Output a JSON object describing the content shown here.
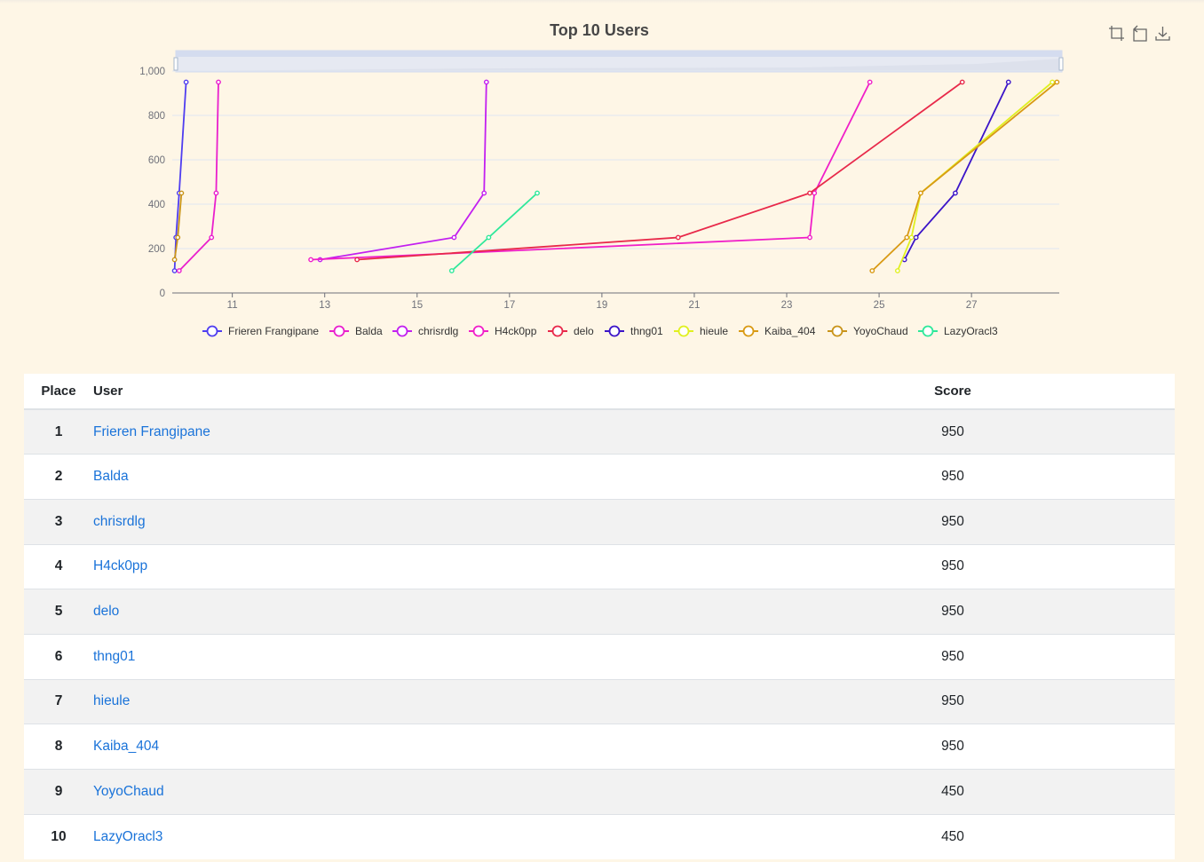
{
  "chart_data": {
    "type": "line",
    "title": "Top 10 Users",
    "xlabel": "",
    "ylabel": "",
    "xlim": [
      9.7,
      28.9
    ],
    "ylim": [
      0,
      1000
    ],
    "x_ticks": [
      "11",
      "13",
      "15",
      "17",
      "19",
      "21",
      "23",
      "25",
      "27"
    ],
    "x_tick_values": [
      11,
      13,
      15,
      17,
      19,
      21,
      23,
      25,
      27
    ],
    "y_ticks": [
      "0",
      "200",
      "400",
      "600",
      "800",
      "1,000"
    ],
    "y_tick_values": [
      0,
      200,
      400,
      600,
      800,
      1000
    ],
    "grid": "horizontal",
    "legend_position": "bottom",
    "series": [
      {
        "name": "Frieren Frangipane",
        "color": "#4f3df0",
        "points": [
          [
            9.75,
            100
          ],
          [
            9.78,
            250
          ],
          [
            9.85,
            450
          ],
          [
            10.0,
            950
          ]
        ]
      },
      {
        "name": "Balda",
        "color": "#e91fcd",
        "points": [
          [
            9.85,
            100
          ],
          [
            10.55,
            250
          ],
          [
            10.65,
            450
          ],
          [
            10.7,
            950
          ]
        ]
      },
      {
        "name": "chrisrdlg",
        "color": "#c21ff0",
        "points": [
          [
            12.9,
            150
          ],
          [
            15.8,
            250
          ],
          [
            16.45,
            450
          ],
          [
            16.5,
            950
          ]
        ]
      },
      {
        "name": "H4ck0pp",
        "color": "#f01fc8",
        "points": [
          [
            12.7,
            150
          ],
          [
            23.5,
            250
          ],
          [
            23.6,
            450
          ],
          [
            24.8,
            950
          ]
        ]
      },
      {
        "name": "delo",
        "color": "#e8294a",
        "points": [
          [
            13.7,
            150
          ],
          [
            20.65,
            250
          ],
          [
            23.5,
            450
          ],
          [
            26.8,
            950
          ]
        ]
      },
      {
        "name": "thng01",
        "color": "#3b14c8",
        "points": [
          [
            25.55,
            150
          ],
          [
            25.8,
            250
          ],
          [
            26.65,
            450
          ],
          [
            27.8,
            950
          ]
        ]
      },
      {
        "name": "hieule",
        "color": "#e0f01f",
        "points": [
          [
            25.4,
            100
          ],
          [
            25.7,
            250
          ],
          [
            25.9,
            450
          ],
          [
            28.75,
            950
          ]
        ]
      },
      {
        "name": "Kaiba_404",
        "color": "#d99a14",
        "points": [
          [
            24.85,
            100
          ],
          [
            25.6,
            250
          ],
          [
            25.9,
            450
          ],
          [
            28.85,
            950
          ]
        ]
      },
      {
        "name": "YoyoChaud",
        "color": "#c9941a",
        "points": [
          [
            9.75,
            150
          ],
          [
            9.82,
            250
          ],
          [
            9.9,
            450
          ]
        ]
      },
      {
        "name": "LazyOracl3",
        "color": "#2ee89a",
        "points": [
          [
            15.75,
            100
          ],
          [
            16.55,
            250
          ],
          [
            17.6,
            450
          ]
        ]
      }
    ]
  },
  "toolbox": {
    "zoom_icon": "zoom-icon",
    "restore_icon": "restore-icon",
    "download_icon": "download-icon"
  },
  "scoreboard": {
    "headers": {
      "place": "Place",
      "user": "User",
      "score": "Score"
    },
    "rows": [
      {
        "place": "1",
        "user": "Frieren Frangipane",
        "score": "950"
      },
      {
        "place": "2",
        "user": "Balda",
        "score": "950"
      },
      {
        "place": "3",
        "user": "chrisrdlg",
        "score": "950"
      },
      {
        "place": "4",
        "user": "H4ck0pp",
        "score": "950"
      },
      {
        "place": "5",
        "user": "delo",
        "score": "950"
      },
      {
        "place": "6",
        "user": "thng01",
        "score": "950"
      },
      {
        "place": "7",
        "user": "hieule",
        "score": "950"
      },
      {
        "place": "8",
        "user": "Kaiba_404",
        "score": "950"
      },
      {
        "place": "9",
        "user": "YoyoChaud",
        "score": "450"
      },
      {
        "place": "10",
        "user": "LazyOracl3",
        "score": "450"
      }
    ]
  }
}
